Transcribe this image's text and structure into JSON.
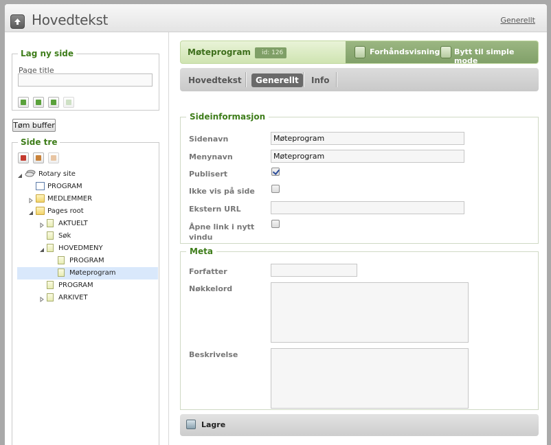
{
  "topbar": {
    "title": "Hovedtekst",
    "link": "Generellt",
    "home_icon": "up-arrow-icon"
  },
  "left": {
    "new_page": {
      "legend": "Lag ny side",
      "field_label": "Page title",
      "field_value": "",
      "icons": [
        "add-page-icon",
        "insert-above-icon",
        "insert-below-icon",
        "insert-disabled-icon"
      ]
    },
    "buffer_button": "Tøm buffer",
    "tree": {
      "legend": "Side tre",
      "toolbar_icons": [
        "delete-icon",
        "copy-icon",
        "paste-icon"
      ],
      "nodes": [
        {
          "label": "Rotary site",
          "depth": 0,
          "expander": "open",
          "icon": "site"
        },
        {
          "label": "PROGRAM",
          "depth": 1,
          "expander": "none",
          "icon": "list"
        },
        {
          "label": "MEDLEMMER",
          "depth": 1,
          "expander": "closed",
          "icon": "folder"
        },
        {
          "label": "Pages root",
          "depth": 1,
          "expander": "open",
          "icon": "folder"
        },
        {
          "label": "AKTUELT",
          "depth": 2,
          "expander": "closed",
          "icon": "page"
        },
        {
          "label": "Søk",
          "depth": 2,
          "expander": "none",
          "icon": "page"
        },
        {
          "label": "HOVEDMENY",
          "depth": 2,
          "expander": "open",
          "icon": "page"
        },
        {
          "label": "PROGRAM",
          "depth": 3,
          "expander": "none",
          "icon": "page"
        },
        {
          "label": "Møteprogram",
          "depth": 3,
          "expander": "none",
          "icon": "page",
          "selected": true
        },
        {
          "label": "PROGRAM",
          "depth": 2,
          "expander": "none",
          "icon": "page"
        },
        {
          "label": "ARKIVET",
          "depth": 2,
          "expander": "closed",
          "icon": "page"
        }
      ]
    }
  },
  "header": {
    "page_name": "Møteprogram",
    "id_badge": "id: 126",
    "preview": "Forhåndsvisning",
    "simple_mode": "Bytt til simple mode"
  },
  "tabs": [
    {
      "label": "Hovedtekst",
      "active": false
    },
    {
      "label": "Generellt",
      "active": true
    },
    {
      "label": "Info",
      "active": false
    }
  ],
  "info": {
    "legend": "Sideinformasjon",
    "sidenavn_label": "Sidenavn",
    "sidenavn_value": "Møteprogram",
    "menynavn_label": "Menynavn",
    "menynavn_value": "Møteprogram",
    "publisert_label": "Publisert",
    "publisert_checked": true,
    "ikke_vis_label": "Ikke vis på side",
    "ikke_vis_checked": false,
    "ekstern_url_label": "Ekstern URL",
    "ekstern_url_value": "",
    "apne_link_label": "Åpne link i nytt vindu",
    "apne_link_checked": false
  },
  "meta": {
    "legend": "Meta",
    "forfatter_label": "Forfatter",
    "forfatter_value": "",
    "nokkelord_label": "Nøkkelord",
    "nokkelord_value": "",
    "beskrivelse_label": "Beskrivelse",
    "beskrivelse_value": ""
  },
  "save": {
    "label": "Lagre"
  },
  "colors": {
    "accent_green": "#3e7d1a",
    "header_dark": "#8aa972",
    "selection": "#d9e8fb"
  }
}
